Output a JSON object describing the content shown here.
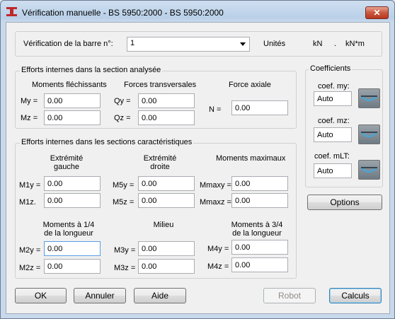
{
  "window": {
    "title": "Vérification manuelle  - BS 5950:2000 - BS 5950:2000",
    "close_glyph": "✕"
  },
  "bar_check": {
    "label": "Vérification de la barre n°:",
    "value": "1"
  },
  "units": {
    "label": "Unités",
    "force": "kN",
    "sep": ".",
    "moment": "kN*m"
  },
  "section_analyzed": {
    "title": "Efforts internes dans la section analysée",
    "bending_moments": "Moments fléchissants",
    "transverse_forces": "Forces transversales",
    "axial_force": "Force axiale",
    "my_label": "My =",
    "my_value": "0.00",
    "mz_label": "Mz =",
    "mz_value": "0.00",
    "qy_label": "Qy =",
    "qy_value": "0.00",
    "qz_label": "Qz =",
    "qz_value": "0.00",
    "n_label": "N =",
    "n_value": "0.00"
  },
  "characteristic_sections": {
    "title": "Efforts internes dans les sections caractéristiques",
    "left_end": "Extrémité\ngauche",
    "right_end": "Extrémité\ndroite",
    "max_moments": "Moments maximaux",
    "quarter": "Moments à 1/4\nde la longueur",
    "middle": "Milieu",
    "three_quarter": "Moments à 3/4\nde la longueur",
    "m1y_label": "M1y =",
    "m1y_value": "0.00",
    "m1z_label": "M1z.",
    "m1z_value": "0.00",
    "m5y_label": "M5y =",
    "m5y_value": "0.00",
    "m5z_label": "M5z =",
    "m5z_value": "0.00",
    "mmaxy_label": "Mmaxy =",
    "mmaxy_value": "0.00",
    "mmaxz_label": "Mmaxz =",
    "mmaxz_value": "0.00",
    "m2y_label": "M2y =",
    "m2y_value": "0.00",
    "m2z_label": "M2z =",
    "m2z_value": "0.00",
    "m3y_label": "M3y =",
    "m3y_value": "0.00",
    "m3z_label": "M3z =",
    "m3z_value": "0.00",
    "m4y_label": "M4y =",
    "m4y_value": "0.00",
    "m4z_label": "M4z =",
    "m4z_value": "0.00"
  },
  "coefficients": {
    "title": "Coefficients",
    "my_label": "coef. my:",
    "my_value": "Auto",
    "mz_label": "coef. mz:",
    "mz_value": "Auto",
    "mlt_label": "coef. mLT:",
    "mlt_value": "Auto",
    "diagram_icon": "moment-diagram-icon"
  },
  "buttons": {
    "options": "Options",
    "ok": "OK",
    "cancel": "Annuler",
    "help": "Aide",
    "robot": "Robot",
    "calc": "Calculs"
  },
  "colors": {
    "close_red": "#c9583f",
    "focus_blue": "#569de5",
    "icon_curve": "#3fa9e0"
  }
}
